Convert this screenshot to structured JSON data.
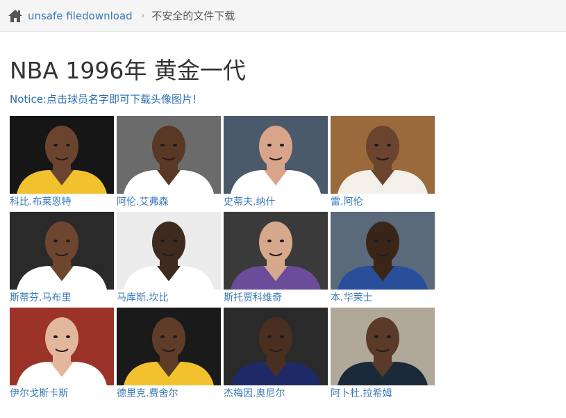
{
  "breadcrumb": {
    "home_icon": "home-icon",
    "link_label": "unsafe filedownload",
    "separator": "›",
    "current_label": "不安全的文件下载"
  },
  "page": {
    "title": "NBA 1996年 黄金一代",
    "notice": "Notice:点击球员名字即可下载头像图片!"
  },
  "players": [
    {
      "name": "科比.布莱恩特",
      "bg": "#161616",
      "skin": "#6b4430",
      "jersey": "#f2c12e"
    },
    {
      "name": "阿伦.艾弗森",
      "bg": "#6b6b6b",
      "skin": "#5a3826",
      "jersey": "#ffffff"
    },
    {
      "name": "史蒂夫.纳什",
      "bg": "#4a5a6b",
      "skin": "#d9a58a",
      "jersey": "#ffffff"
    },
    {
      "name": "雷.阿伦",
      "bg": "#9a6a3c",
      "skin": "#6a442e",
      "jersey": "#f3f0ea"
    },
    {
      "name": "斯蒂芬.马布里",
      "bg": "#2a2a2a",
      "skin": "#6e4630",
      "jersey": "#ffffff"
    },
    {
      "name": "马库斯.坎比",
      "bg": "#ececec",
      "skin": "#3f2a20",
      "jersey": "#ffffff"
    },
    {
      "name": "斯托贾科维奇",
      "bg": "#3a3a3a",
      "skin": "#d6a98c",
      "jersey": "#6b4c9a"
    },
    {
      "name": "本.华莱士",
      "bg": "#5a6a7a",
      "skin": "#3a2519",
      "jersey": "#2a4f9a"
    },
    {
      "name": "伊尔戈斯卡斯",
      "bg": "#9b3328",
      "skin": "#e3b79c",
      "jersey": "#ffffff"
    },
    {
      "name": "德里克.费舍尔",
      "bg": "#1a1a1a",
      "skin": "#5e3c28",
      "jersey": "#f2c12e"
    },
    {
      "name": "杰梅因.奥尼尔",
      "bg": "#2a2a2a",
      "skin": "#4a2f20",
      "jersey": "#1d2a66"
    },
    {
      "name": "阿卜杜.拉希姆",
      "bg": "#b0a898",
      "skin": "#5a3a28",
      "jersey": "#1b2a3a"
    }
  ]
}
